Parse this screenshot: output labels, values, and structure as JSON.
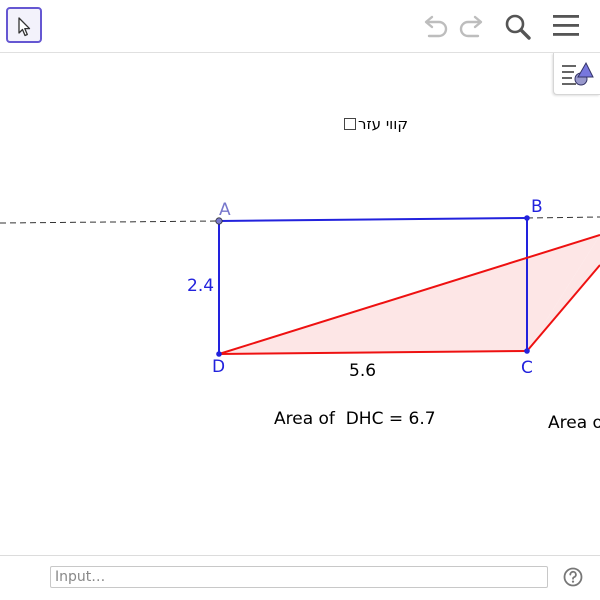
{
  "toolbar": {
    "icons": {
      "move": "arrow-cursor-icon",
      "undo": "undo-icon",
      "redo": "redo-icon",
      "search": "search-icon",
      "menu": "menu-icon"
    }
  },
  "style_bar": {
    "icon": "style-bar-icon"
  },
  "checkbox": {
    "label": "קווי עזר",
    "checked": false
  },
  "construction": {
    "points": {
      "A": "A",
      "B": "B",
      "C": "C",
      "D": "D"
    },
    "lengths": {
      "side_ad": "2.4",
      "side_dc": "5.6"
    },
    "areas": {
      "dhc": "Area of  DHC = 6.7",
      "second": "Area o"
    },
    "colors": {
      "rectangle": "#2222dd",
      "triangle": "#ee1111",
      "fill": "#fde6e6",
      "point_a": "#7777cc"
    }
  },
  "input_bar": {
    "placeholder": "Input…",
    "help_icon": "help-icon"
  }
}
